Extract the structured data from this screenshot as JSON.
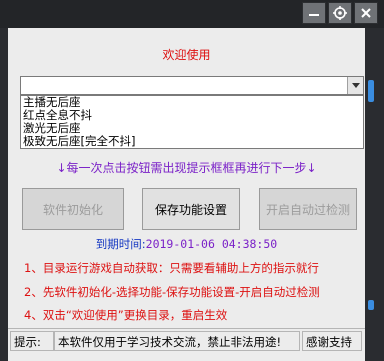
{
  "window": {
    "title": "",
    "buttons": [
      "minimize",
      "settings",
      "close"
    ]
  },
  "main": {
    "welcome": "欢迎使用",
    "combo_value": "",
    "options": [
      "主播无后座",
      "红点全息不抖",
      "激光无后座",
      "极致无后座[完全不抖]"
    ],
    "instruction": "↓每一次点击按钮需出现提示框框再进行下一步↓",
    "buttons": {
      "init": "软件初始化",
      "save": "保存功能设置",
      "auto": "开启自动过检测"
    },
    "expiry_label": "到期时间:",
    "expiry_value": "2019-01-06 04:38:50",
    "info": [
      "1、目录运行游戏自动获取：只需要看辅助上方的指示就行",
      "2、先软件初始化-选择功能-保存功能设置-开启自动过检测",
      "4、双击“欢迎使用”更换目录，重启生效"
    ]
  },
  "status": {
    "label": "提示:",
    "message": "本软件仅用于学习技术交流，禁止非法用途!",
    "thanks": "感谢支持"
  },
  "colors": {
    "accent_red": "#dd1111",
    "accent_purple": "#7b22c8",
    "accent_blue": "#1537c2",
    "frame": "#1f2124"
  }
}
